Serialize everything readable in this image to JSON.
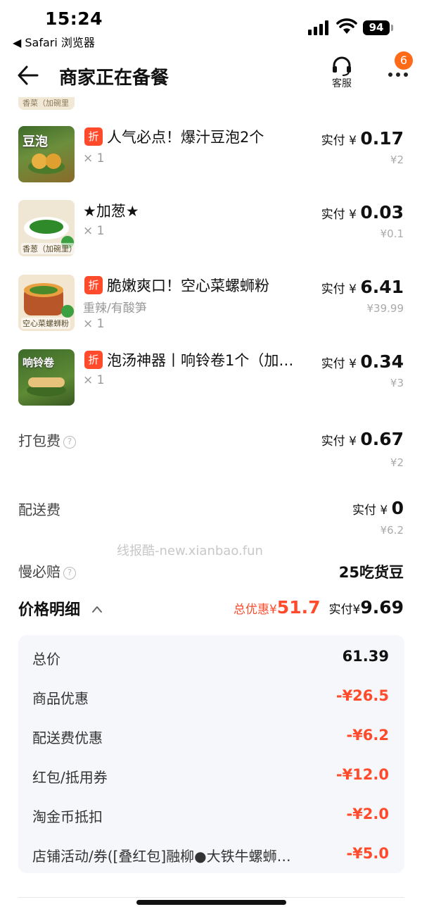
{
  "status_bar": {
    "time": "15:24",
    "back_app": "◀ Safari 浏览器",
    "battery": "94"
  },
  "nav": {
    "title": "商家正在备餐",
    "service_label": "客服",
    "more_badge": "6"
  },
  "cut_item": {
    "caption": "香菜（加碗里"
  },
  "items": [
    {
      "tag": "折",
      "name": "人气必点！爆汁豆泡2个",
      "spec": "",
      "qty": "× 1",
      "pay_label": "实付 ¥ ",
      "pay": "0.17",
      "orig": "¥2",
      "thumb_text": "豆泡",
      "thumb_caption": ""
    },
    {
      "tag": "",
      "name": "★加葱★",
      "spec": "",
      "qty": "× 1",
      "pay_label": "实付 ¥ ",
      "pay": "0.03",
      "orig": "¥0.1",
      "thumb_text": "",
      "thumb_caption": "香葱（加碗里）"
    },
    {
      "tag": "折",
      "name": "脆嫩爽口！空心菜螺蛳粉",
      "spec": "重辣/有酸笋",
      "qty": "× 1",
      "pay_label": "实付 ¥ ",
      "pay": "6.41",
      "orig": "¥39.99",
      "thumb_text": "",
      "thumb_caption": "空心菜螺蛳粉"
    },
    {
      "tag": "折",
      "name": "泡汤神器丨响铃卷1个（加…",
      "spec": "",
      "qty": "× 1",
      "pay_label": "实付 ¥ ",
      "pay": "0.34",
      "orig": "¥3",
      "thumb_text": "响铃卷",
      "thumb_caption": ""
    }
  ],
  "fees": {
    "packing": {
      "label": "打包费",
      "pay_label": "实付 ¥ ",
      "pay": "0.67",
      "orig": "¥2"
    },
    "delivery": {
      "label": "配送费",
      "pay_label": "实付 ¥ ",
      "pay": "0",
      "orig": "¥6.2"
    },
    "slow": {
      "label": "慢必赔",
      "value": "25吃货豆"
    }
  },
  "watermark": "线报酷-new.xianbao.fun",
  "price_detail": {
    "title": "价格明细",
    "discount_label": "总优惠¥",
    "discount": "51.7",
    "total_label": "实付¥",
    "total": "9.69",
    "rows": [
      {
        "label": "总价",
        "value": "61.39"
      },
      {
        "label": "商品优惠",
        "value": "-¥26.5"
      },
      {
        "label": "配送费优惠",
        "value": "-¥6.2"
      },
      {
        "label": "红包/抵用券",
        "value": "-¥12.0"
      },
      {
        "label": "淘金币抵扣",
        "value": "-¥2.0"
      },
      {
        "label": "店铺活动/券([叠红包]融柳●大铁牛螺蛳…",
        "value": "-¥5.0"
      }
    ]
  },
  "colors": {
    "accent": "#ff4b2b",
    "badge": "#ff6a19",
    "panel": "#f5f7fa"
  }
}
